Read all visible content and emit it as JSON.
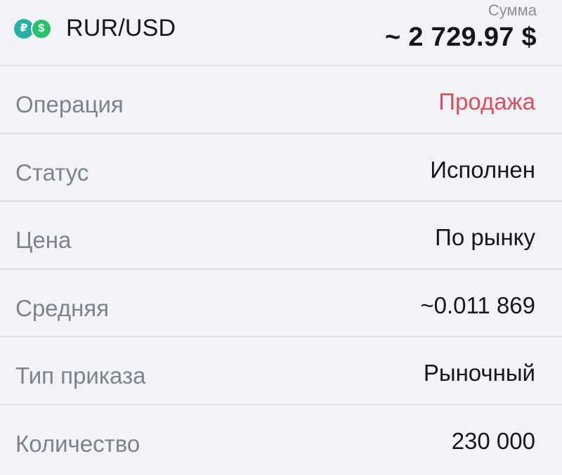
{
  "header": {
    "pair": "RUR/USD",
    "icons": {
      "base": {
        "name": "ruble-coin-icon",
        "glyph": "₽",
        "color": "#23b3a4"
      },
      "quote": {
        "name": "dollar-coin-icon",
        "glyph": "$",
        "color": "#27c26a"
      }
    },
    "sum_label": "Сумма",
    "sum_value": "~ 2 729.97 $"
  },
  "rows": [
    {
      "label": "Операция",
      "value": "Продажа",
      "value_color": "#e14d5c"
    },
    {
      "label": "Статус",
      "value": "Исполнен"
    },
    {
      "label": "Цена",
      "value": "По рынку"
    },
    {
      "label": "Средняя",
      "value": "~0.011 869"
    },
    {
      "label": "Тип приказа",
      "value": "Рыночный"
    },
    {
      "label": "Количество",
      "value": "230 000"
    }
  ]
}
